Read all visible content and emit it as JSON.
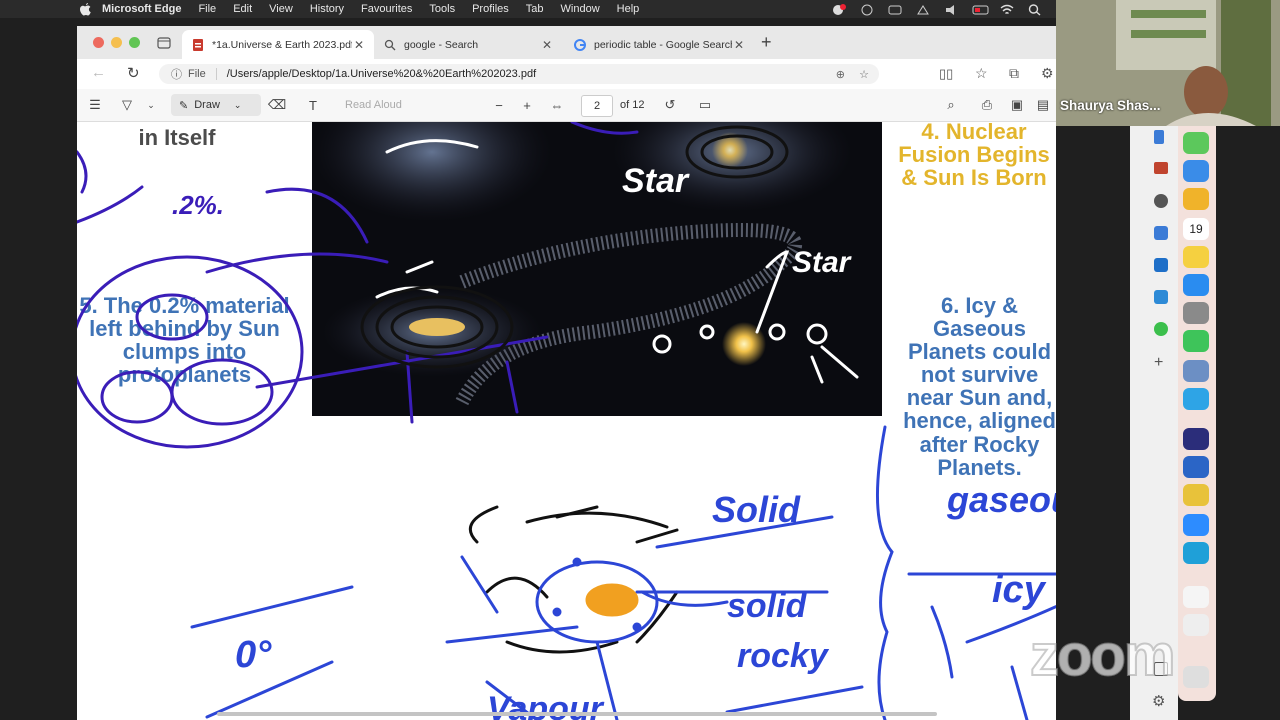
{
  "menubar": {
    "items": [
      "Microsoft Edge",
      "File",
      "Edit",
      "View",
      "History",
      "Favourites",
      "Tools",
      "Profiles",
      "Tab",
      "Window",
      "Help"
    ]
  },
  "tabs": [
    {
      "title": "*1a.Universe & Earth 2023.pdf",
      "active": true
    },
    {
      "title": "google - Search",
      "active": false
    },
    {
      "title": "periodic table - Google Search",
      "active": false
    }
  ],
  "address": {
    "prefix": "File",
    "url": "/Users/apple/Desktop/1a.Universe%20&%20Earth%202023.pdf"
  },
  "pdf_toolbar": {
    "draw_label": "Draw",
    "read_aloud_label": "Read Aloud",
    "page_number": "2",
    "page_total": "of 12"
  },
  "pdf_content": {
    "top_left_text": "in Itself",
    "step4_text": "4. Nuclear Fusion Begins & Sun Is Born",
    "step5_text": "5. The 0.2% material left behind by Sun clumps into protoplanets",
    "step6_text": "6. Icy & Gaseous Planets could not survive near Sun and, hence, aligned after Rocky Planets."
  },
  "annotations": {
    "percent": ".2%.",
    "star1": "Star",
    "star2": "Star",
    "solid1": "Solid",
    "solid2": "solid",
    "rocky": "rocky",
    "gaseous": "gaseous",
    "icy": "icy",
    "zero": "0°",
    "bottom": "Vapour"
  },
  "dock": {
    "calendar_day": "19"
  },
  "webcam": {
    "name": "Shaurya Shas..."
  },
  "watermark": "zoom",
  "colors": {
    "ink_blue": "#2c46d6",
    "ink_purple": "#3a1db8",
    "ink_black": "#111111",
    "pdf_blue": "#3f73b6",
    "pdf_gold": "#e3b52c",
    "dock_bg": "#f3e1dc"
  }
}
